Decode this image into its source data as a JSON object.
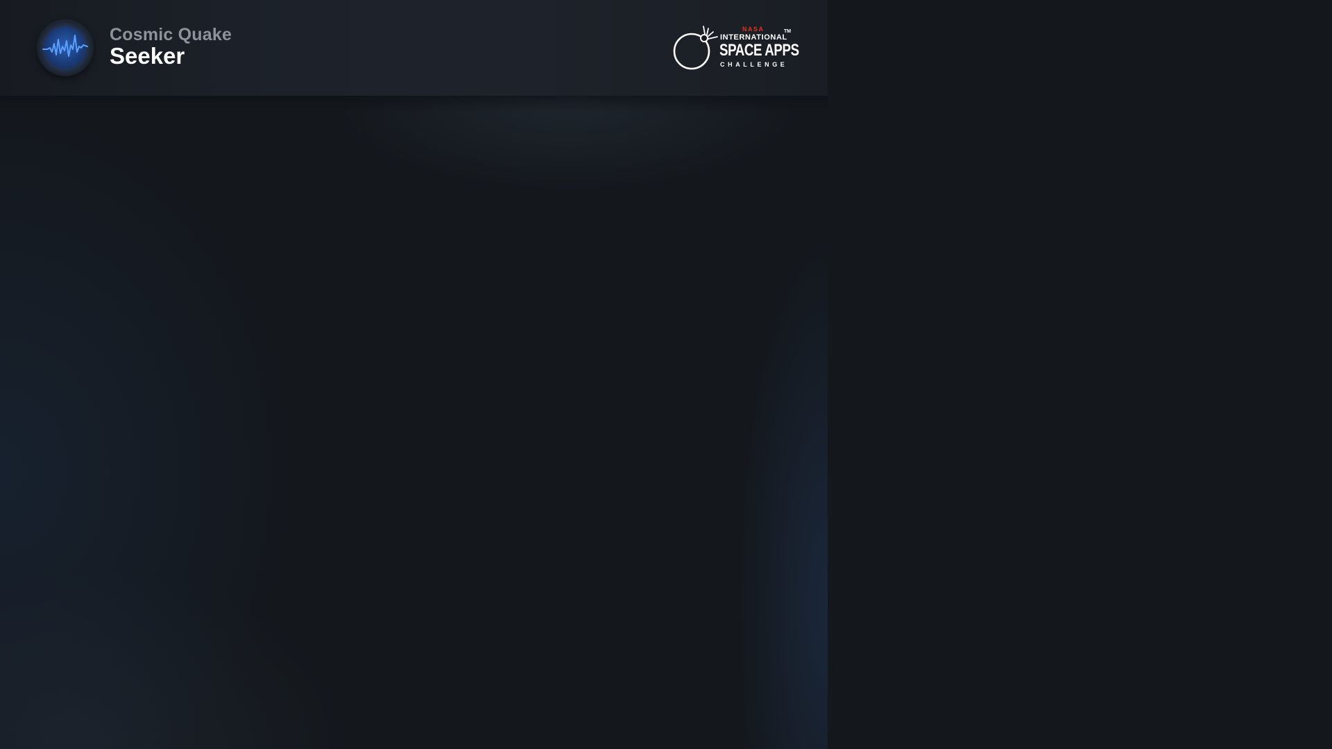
{
  "brand": {
    "name_line1": "Cosmic Quake",
    "name_line2": "Seeker",
    "logo_icon": "seismic-wave-icon"
  },
  "sponsor": {
    "agency": "NASA",
    "line1": "INTERNATIONAL",
    "line2": "SPACE APPS",
    "line3": "CHALLENGE",
    "trademark": "TM",
    "logo_icon": "space-apps-logo-icon"
  },
  "colors": {
    "background": "#13171c",
    "header": "#1e232b",
    "accent_blue": "#4a8cff",
    "nasa_red": "#e0321f",
    "brand_subtitle": "#8d939b",
    "brand_title": "#ffffff"
  }
}
